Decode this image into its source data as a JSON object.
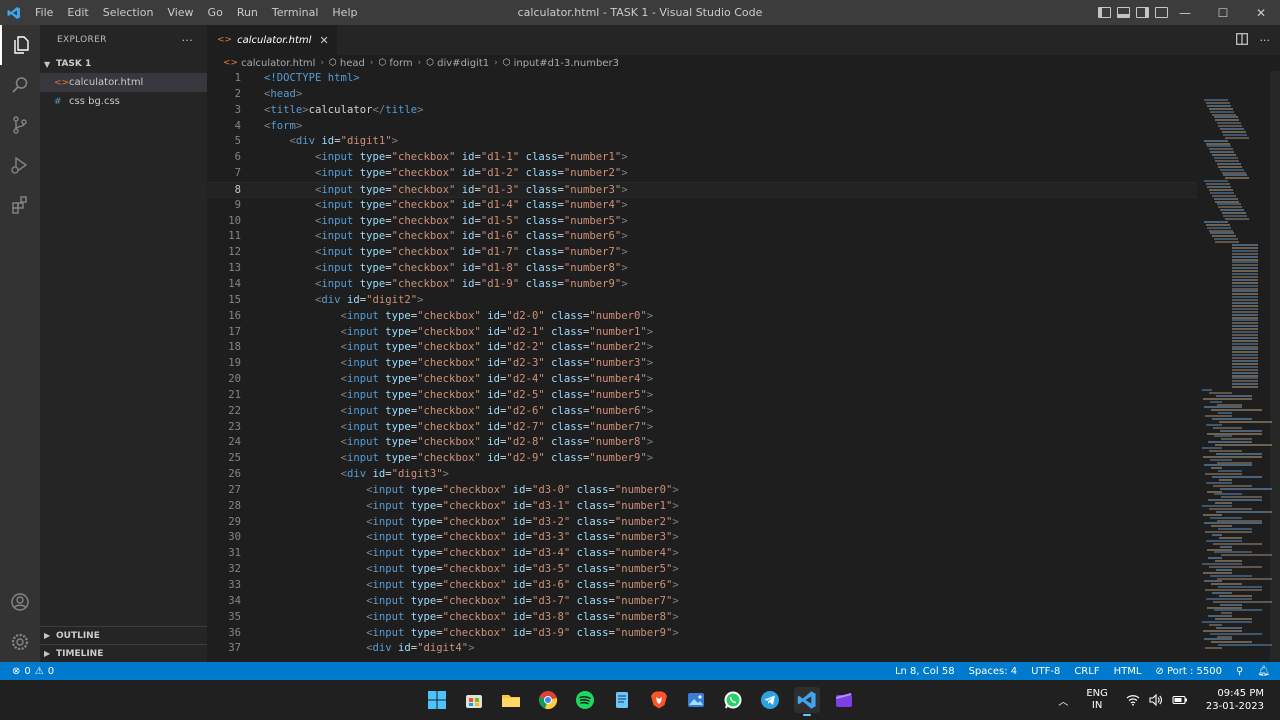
{
  "titlebar": {
    "menu": [
      "File",
      "Edit",
      "Selection",
      "View",
      "Go",
      "Run",
      "Terminal",
      "Help"
    ],
    "title": "calculator.html - TASK 1 - Visual Studio Code",
    "controls": {
      "minimize": "—",
      "maximize": "☐",
      "close": "✕"
    }
  },
  "activitybar": {
    "top": [
      "explorer-icon",
      "search-icon",
      "source-control-icon",
      "run-debug-icon",
      "extensions-icon"
    ],
    "bottom": [
      "account-icon",
      "settings-gear-icon"
    ]
  },
  "sidebar": {
    "title": "EXPLORER",
    "more": "···",
    "folder": "TASK 1",
    "files": [
      {
        "icon": "<>",
        "name": "calculator.html",
        "selected": true
      },
      {
        "icon": "#",
        "name": "css bg.css",
        "selected": false
      }
    ],
    "outline": "OUTLINE",
    "timeline": "TIMELINE"
  },
  "tabs": [
    {
      "icon": "<>",
      "label": "calculator.html",
      "close": "✕"
    }
  ],
  "breadcrumb": [
    "calculator.html",
    "head",
    "form",
    "div#digit1",
    "input#d1-3.number3"
  ],
  "editor": {
    "current_line": 8,
    "lines": [
      {
        "n": "1",
        "indent": "",
        "t": "doctype",
        "code": "<!DOCTYPE html>"
      },
      {
        "n": "2",
        "indent": "",
        "t": "open",
        "tag": "head"
      },
      {
        "n": "3",
        "indent": "",
        "t": "title",
        "text": "calculator"
      },
      {
        "n": "4",
        "indent": "",
        "t": "open",
        "tag": "form"
      },
      {
        "n": "5",
        "indent": "    ",
        "t": "div",
        "id": "digit1"
      },
      {
        "n": "6",
        "indent": "        ",
        "t": "input",
        "id": "d1-1",
        "cls": "number1"
      },
      {
        "n": "7",
        "indent": "        ",
        "t": "input",
        "id": "d1-2",
        "cls": "number2"
      },
      {
        "n": "8",
        "indent": "        ",
        "t": "input",
        "id": "d1-3",
        "cls": "number3"
      },
      {
        "n": "9",
        "indent": "        ",
        "t": "input",
        "id": "d1-4",
        "cls": "number4"
      },
      {
        "n": "10",
        "indent": "        ",
        "t": "input",
        "id": "d1-5",
        "cls": "number5"
      },
      {
        "n": "11",
        "indent": "        ",
        "t": "input",
        "id": "d1-6",
        "cls": "number6"
      },
      {
        "n": "12",
        "indent": "        ",
        "t": "input",
        "id": "d1-7",
        "cls": "number7"
      },
      {
        "n": "13",
        "indent": "        ",
        "t": "input",
        "id": "d1-8",
        "cls": "number8"
      },
      {
        "n": "14",
        "indent": "        ",
        "t": "input",
        "id": "d1-9",
        "cls": "number9"
      },
      {
        "n": "15",
        "indent": "        ",
        "t": "div",
        "id": "digit2"
      },
      {
        "n": "16",
        "indent": "            ",
        "t": "input",
        "id": "d2-0",
        "cls": "number0"
      },
      {
        "n": "17",
        "indent": "            ",
        "t": "input",
        "id": "d2-1",
        "cls": "number1"
      },
      {
        "n": "18",
        "indent": "            ",
        "t": "input",
        "id": "d2-2",
        "cls": "number2"
      },
      {
        "n": "19",
        "indent": "            ",
        "t": "input",
        "id": "d2-3",
        "cls": "number3"
      },
      {
        "n": "20",
        "indent": "            ",
        "t": "input",
        "id": "d2-4",
        "cls": "number4"
      },
      {
        "n": "21",
        "indent": "            ",
        "t": "input",
        "id": "d2-5",
        "cls": "number5"
      },
      {
        "n": "22",
        "indent": "            ",
        "t": "input",
        "id": "d2-6",
        "cls": "number6"
      },
      {
        "n": "23",
        "indent": "            ",
        "t": "input",
        "id": "d2-7",
        "cls": "number7"
      },
      {
        "n": "24",
        "indent": "            ",
        "t": "input",
        "id": "d2-8",
        "cls": "number8"
      },
      {
        "n": "25",
        "indent": "            ",
        "t": "input",
        "id": "d2-9",
        "cls": "number9"
      },
      {
        "n": "26",
        "indent": "            ",
        "t": "div",
        "id": "digit3"
      },
      {
        "n": "27",
        "indent": "                ",
        "t": "input",
        "id": "d3-0",
        "cls": "number0"
      },
      {
        "n": "28",
        "indent": "                ",
        "t": "input",
        "id": "d3-1",
        "cls": "number1"
      },
      {
        "n": "29",
        "indent": "                ",
        "t": "input",
        "id": "d3-2",
        "cls": "number2"
      },
      {
        "n": "30",
        "indent": "                ",
        "t": "input",
        "id": "d3-3",
        "cls": "number3"
      },
      {
        "n": "31",
        "indent": "                ",
        "t": "input",
        "id": "d3-4",
        "cls": "number4"
      },
      {
        "n": "32",
        "indent": "                ",
        "t": "input",
        "id": "d3-5",
        "cls": "number5"
      },
      {
        "n": "33",
        "indent": "                ",
        "t": "input",
        "id": "d3-6",
        "cls": "number6"
      },
      {
        "n": "34",
        "indent": "                ",
        "t": "input",
        "id": "d3-7",
        "cls": "number7"
      },
      {
        "n": "35",
        "indent": "                ",
        "t": "input",
        "id": "d3-8",
        "cls": "number8"
      },
      {
        "n": "36",
        "indent": "                ",
        "t": "input",
        "id": "d3-9",
        "cls": "number9"
      },
      {
        "n": "37",
        "indent": "                ",
        "t": "div",
        "id": "digit4"
      }
    ]
  },
  "statusbar": {
    "errors": "0",
    "warnings": "0",
    "position": "Ln 8, Col 58",
    "spaces": "Spaces: 4",
    "encoding": "UTF-8",
    "eol": "CRLF",
    "language": "HTML",
    "port": "Port : 5500"
  },
  "taskbar": {
    "apps": [
      "windows-start-icon",
      "store-icon",
      "file-explorer-icon",
      "chrome-icon",
      "spotify-icon",
      "notepad-icon",
      "brave-icon",
      "photos-icon",
      "whatsapp-icon",
      "telegram-icon",
      "vscode-icon",
      "clipchamp-icon"
    ],
    "lang1": "ENG",
    "lang2": "IN",
    "time": "09:45 PM",
    "date": "23-01-2023"
  },
  "colors": {
    "statusbar": "#007acc",
    "activitybar": "#333333",
    "sidebar": "#252526",
    "editor": "#1e1e1e",
    "tag": "#569cd6",
    "attr": "#9cdcfe",
    "string": "#ce9178"
  }
}
